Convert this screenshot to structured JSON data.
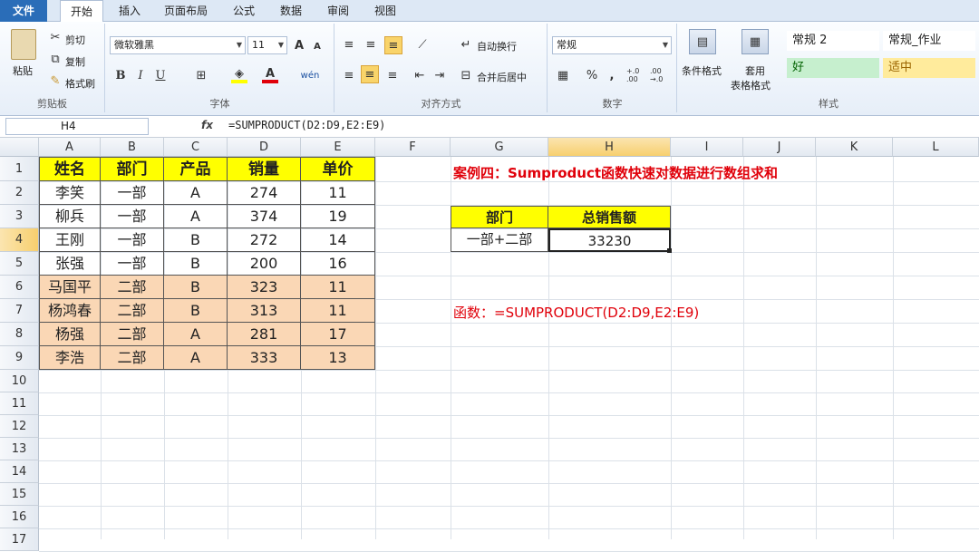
{
  "tabs": [
    "文件",
    "开始",
    "插入",
    "页面布局",
    "公式",
    "数据",
    "审阅",
    "视图"
  ],
  "ribbon": {
    "clipboard": {
      "paste": "粘贴",
      "cut": "剪切",
      "copy": "复制",
      "painter": "格式刷",
      "label": "剪贴板"
    },
    "font": {
      "name": "微软雅黑",
      "size": "11",
      "label": "字体",
      "bold": "B",
      "italic": "I",
      "underline": "U",
      "grow": "A",
      "shrink": "A",
      "fontcolor": "A",
      "phonetic": "wén"
    },
    "align": {
      "wrap": "自动换行",
      "merge": "合并后居中",
      "label": "对齐方式"
    },
    "number": {
      "format": "常规",
      "percent": "%",
      "comma": ",",
      "label": "数字",
      "inc": "+.0 .00",
      "dec": ".00 →.0"
    },
    "styles": {
      "cond": "条件格式",
      "table_l1": "套用",
      "table_l2": "表格格式",
      "label": "样式",
      "s1": "常规 2",
      "s2": "常规_作业",
      "s3": "好",
      "s4": "适中"
    }
  },
  "formula_bar": {
    "cell": "H4",
    "fx": "fx",
    "formula": "=SUMPRODUCT(D2:D9,E2:E9)"
  },
  "columns": [
    "A",
    "B",
    "C",
    "D",
    "E",
    "F",
    "G",
    "H",
    "I",
    "J",
    "K",
    "L"
  ],
  "rows": [
    "1",
    "2",
    "3",
    "4",
    "5",
    "6",
    "7",
    "8",
    "9",
    "10",
    "11",
    "12",
    "13",
    "14",
    "15",
    "16",
    "17"
  ],
  "table": {
    "headers": [
      "姓名",
      "部门",
      "产品",
      "销量",
      "单价"
    ],
    "rows": [
      [
        "李笑",
        "一部",
        "A",
        "274",
        "11"
      ],
      [
        "柳兵",
        "一部",
        "A",
        "374",
        "19"
      ],
      [
        "王刚",
        "一部",
        "B",
        "272",
        "14"
      ],
      [
        "张强",
        "一部",
        "B",
        "200",
        "16"
      ],
      [
        "马国平",
        "二部",
        "B",
        "323",
        "11"
      ],
      [
        "杨鸿春",
        "二部",
        "B",
        "313",
        "11"
      ],
      [
        "杨强",
        "二部",
        "A",
        "281",
        "17"
      ],
      [
        "李浩",
        "二部",
        "A",
        "333",
        "13"
      ]
    ]
  },
  "summary": {
    "h1": "部门",
    "h2": "总销售额",
    "v1": "一部+二部",
    "v2": "33230"
  },
  "title": "案例四：Sumproduct函数快速对数据进行数组求和",
  "note": "函数：=SUMPRODUCT(D2:D9,E2:E9)",
  "colors": {
    "header_yellow": "#ffff00",
    "peach": "#fad7b5",
    "red": "#e0000a",
    "selection": "#f7cf6e"
  }
}
